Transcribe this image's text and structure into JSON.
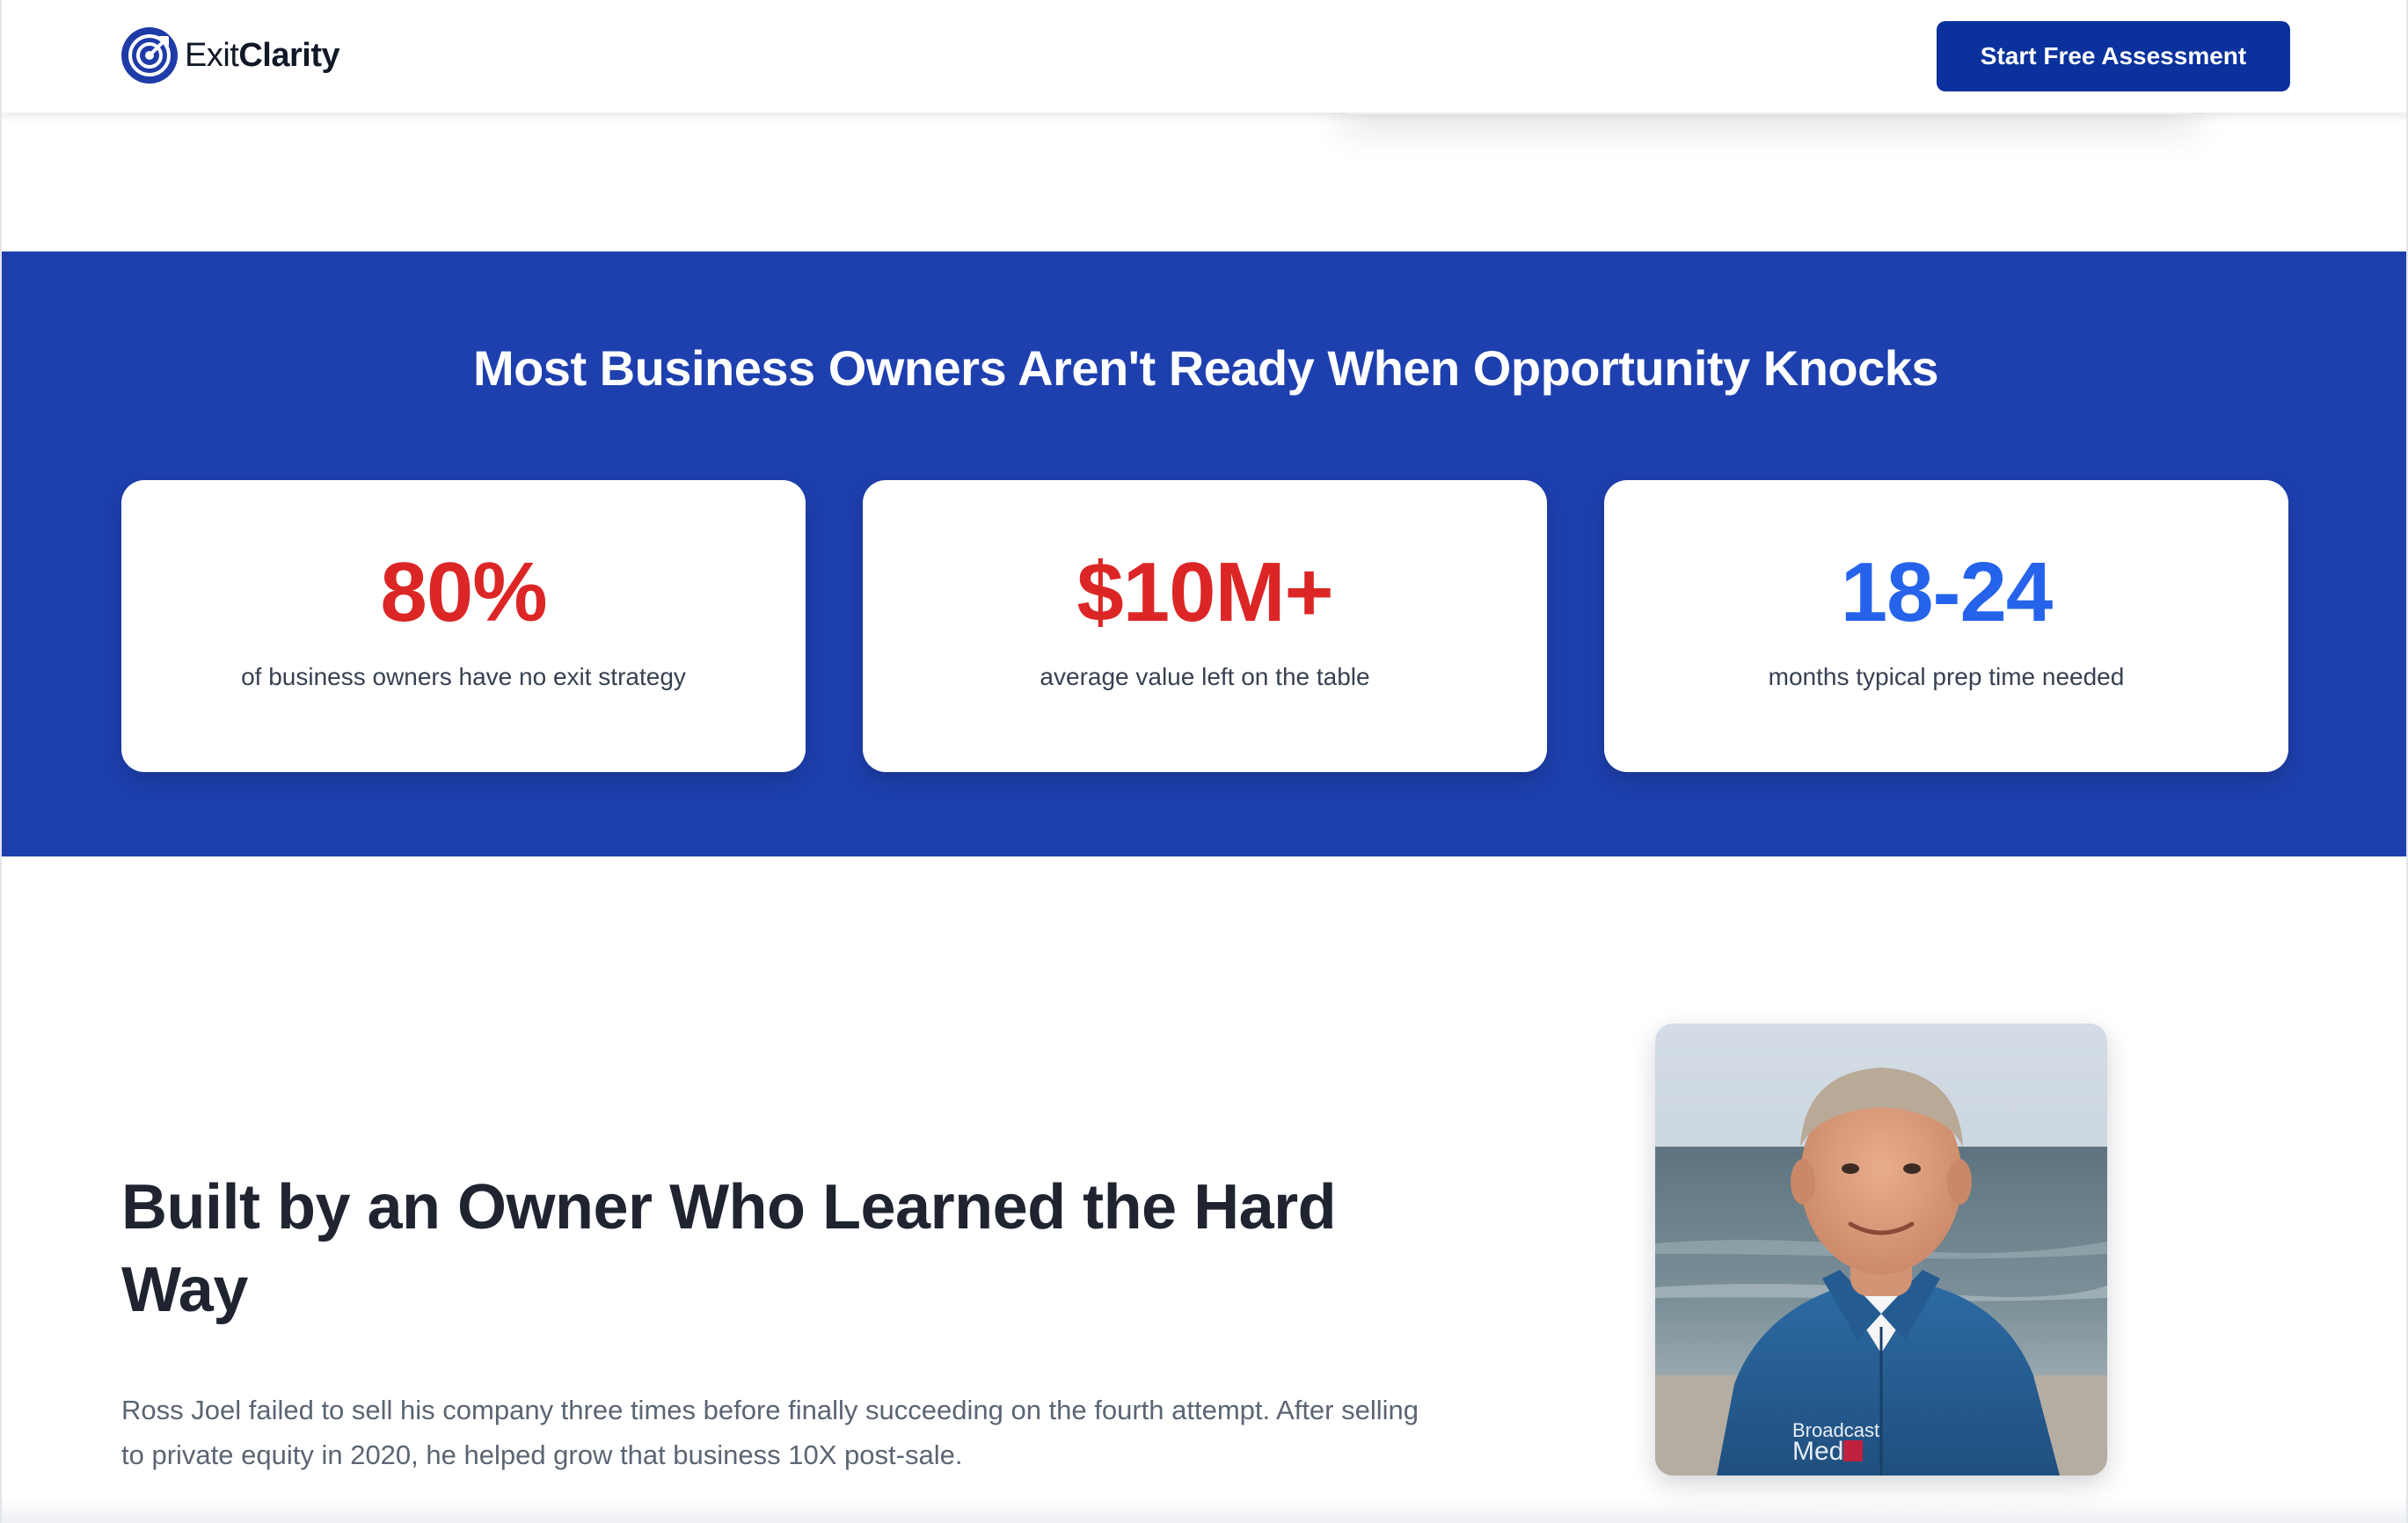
{
  "header": {
    "logo_prefix": "Exit",
    "logo_strong": "Clarity",
    "cta_label": "Start Free Assessment"
  },
  "stats": {
    "title": "Most Business Owners Aren't Ready When Opportunity Knocks",
    "cards": [
      {
        "value": "80%",
        "label": "of business owners have no exit strategy",
        "color": "#dc2626"
      },
      {
        "value": "$10M+",
        "label": "average value left on the table",
        "color": "#dc2626"
      },
      {
        "value": "18-24",
        "label": "months typical prep time needed",
        "color": "#2563eb"
      }
    ]
  },
  "about": {
    "title": "Built by an Owner Who Learned the Hard Way",
    "text": "Ross Joel failed to sell his company three times before finally succeeding on the fourth attempt. After selling to private equity in 2020, he helped grow that business 10X post-sale.",
    "portrait_jacket_text_1": "Broadcast",
    "portrait_jacket_text_2": "Med"
  },
  "colors": {
    "brand_navy": "#0a319c",
    "band_blue": "#1e40af",
    "stat_red": "#dc2626",
    "stat_blue": "#2563eb"
  }
}
